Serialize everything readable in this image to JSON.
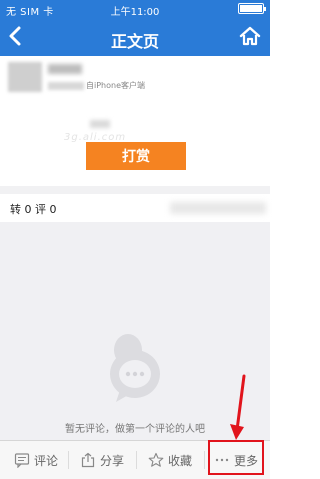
{
  "status_bar": {
    "carrier": "无 SIM 卡",
    "time": "上午11:00"
  },
  "header": {
    "title": "正文页"
  },
  "post": {
    "source": "自iPhone客户端",
    "watermark": "3g.ali.com",
    "reward_label": "打赏"
  },
  "stats": {
    "text": "转 0 评 0"
  },
  "comments": {
    "empty_text": "暂无评论，做第一个评论的人吧"
  },
  "bottom_bar": {
    "comment_label": "评论",
    "share_label": "分享",
    "favorite_label": "收藏",
    "more_label": "更多"
  },
  "colors": {
    "header": "#2a7bd7",
    "reward": "#f58321",
    "highlight": "#e1141c"
  }
}
